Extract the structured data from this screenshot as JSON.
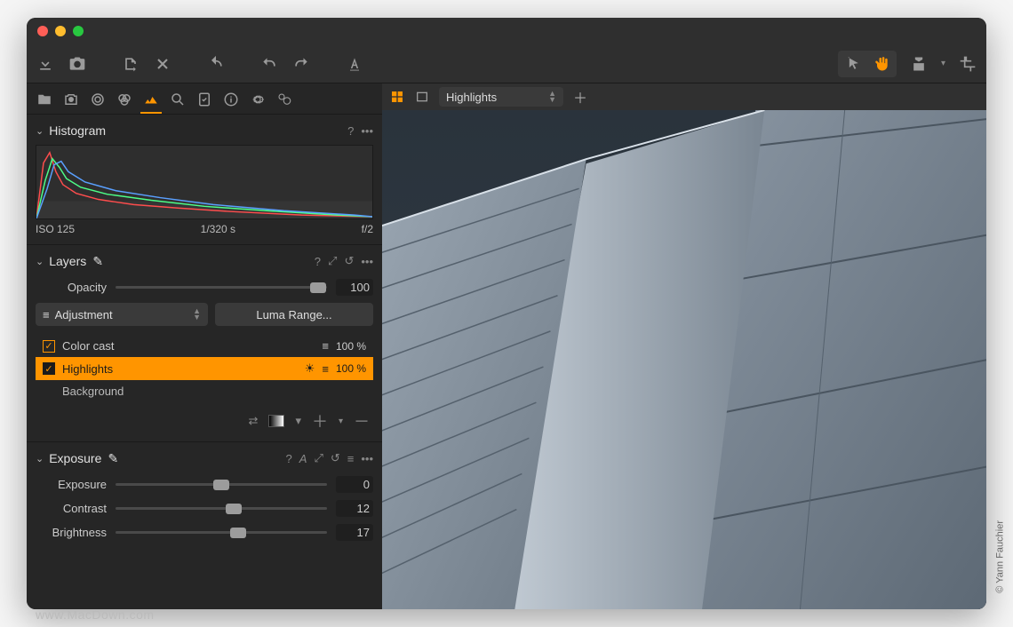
{
  "viewer": {
    "proof_selected": "Highlights"
  },
  "panels": {
    "histogram": {
      "title": "Histogram",
      "iso": "ISO 125",
      "shutter": "1/320 s",
      "aperture": "f/2"
    },
    "layers": {
      "title": "Layers",
      "opacity_label": "Opacity",
      "opacity_value": "100",
      "type_select": "Adjustment",
      "luma_button": "Luma Range...",
      "items": [
        {
          "name": "Color cast",
          "pct": "100 %",
          "checked": true,
          "selected": false
        },
        {
          "name": "Highlights",
          "pct": "100 %",
          "checked": true,
          "selected": true
        },
        {
          "name": "Background",
          "pct": "",
          "checked": false,
          "selected": false
        }
      ]
    },
    "exposure": {
      "title": "Exposure",
      "rows": [
        {
          "label": "Exposure",
          "value": "0",
          "pos": 50
        },
        {
          "label": "Contrast",
          "value": "12",
          "pos": 56
        },
        {
          "label": "Brightness",
          "value": "17",
          "pos": 58
        }
      ]
    }
  },
  "credit": "© Yann Fauchier",
  "watermark": "www.MacDown.com"
}
